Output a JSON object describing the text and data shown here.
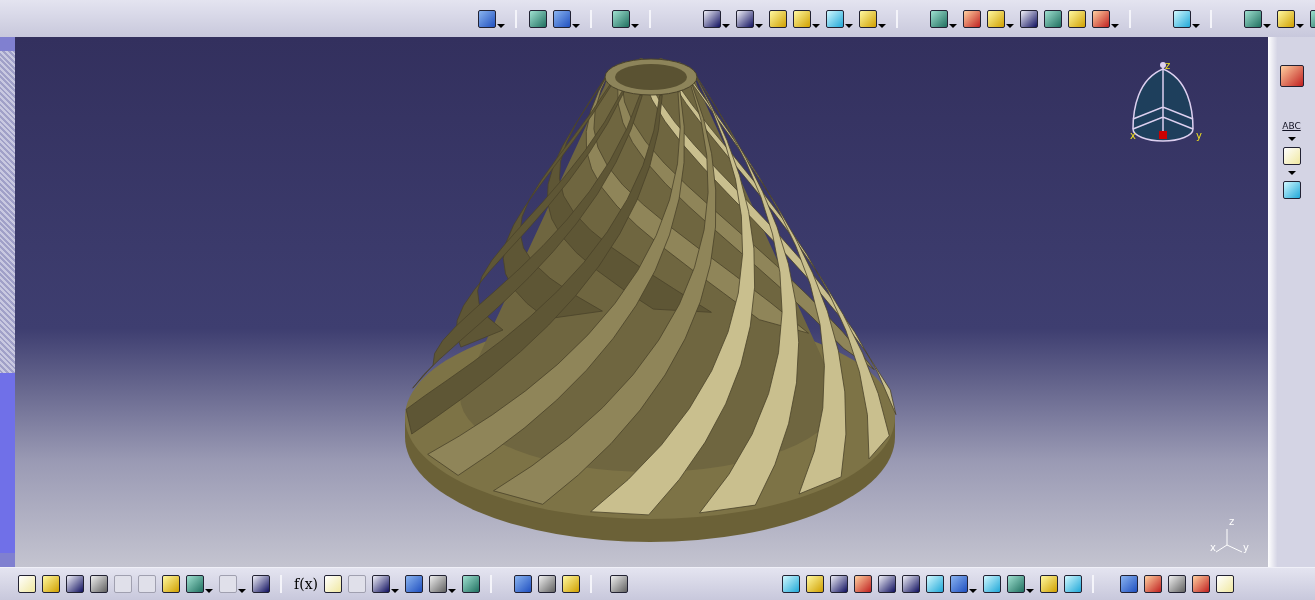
{
  "viewport": {
    "compass": {
      "labels": [
        "z",
        "x",
        "y"
      ]
    },
    "axis_triad": {
      "labels": [
        "z",
        "x",
        "y"
      ]
    }
  },
  "right_toolbar": {
    "annotation_label": "ABC"
  },
  "bottom_toolbar": {
    "formula_label": "f(x)"
  }
}
